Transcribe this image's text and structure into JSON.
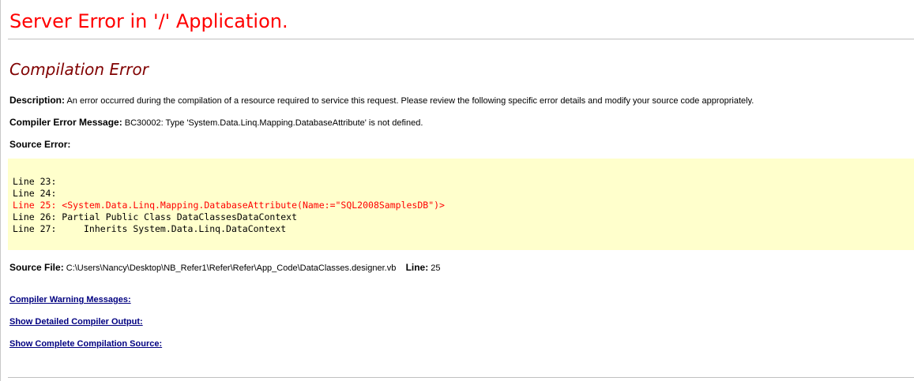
{
  "page": {
    "title": "Server Error in '/' Application.",
    "subtitle": "Compilation Error"
  },
  "description": {
    "label": "Description:",
    "text": " An error occurred during the compilation of a resource required to service this request. Please review the following specific error details and modify your source code appropriately."
  },
  "compiler_error": {
    "label": "Compiler Error Message:",
    "text": " BC30002: Type 'System.Data.Linq.Mapping.DatabaseAttribute' is not defined."
  },
  "source_error": {
    "label": "Source Error:",
    "lines": [
      {
        "text": "Line 23: ",
        "highlight": false
      },
      {
        "text": "Line 24: ",
        "highlight": false
      },
      {
        "text": "Line 25: <System.Data.Linq.Mapping.DatabaseAttribute(Name:=\"SQL2008SamplesDB\")>",
        "highlight": true
      },
      {
        "text": "Line 26: Partial Public Class DataClassesDataContext",
        "highlight": false
      },
      {
        "text": "Line 27:     Inherits System.Data.Linq.DataContext",
        "highlight": false
      }
    ]
  },
  "source_file": {
    "label": "Source File:",
    "path": " C:\\Users\\Nancy\\Desktop\\NB_Refer1\\Refer\\Refer\\App_Code\\DataClasses.designer.vb",
    "line_label": "Line:",
    "line_value": " 25"
  },
  "links": {
    "warnings": "Compiler Warning Messages:",
    "detailed_output": "Show Detailed Compiler Output:",
    "complete_source": "Show Complete Compilation Source:"
  },
  "colors": {
    "title": "#ff0000",
    "subtitle": "#800000",
    "code_background": "#ffffcc",
    "error_line": "#ff0000",
    "link": "#000080"
  }
}
